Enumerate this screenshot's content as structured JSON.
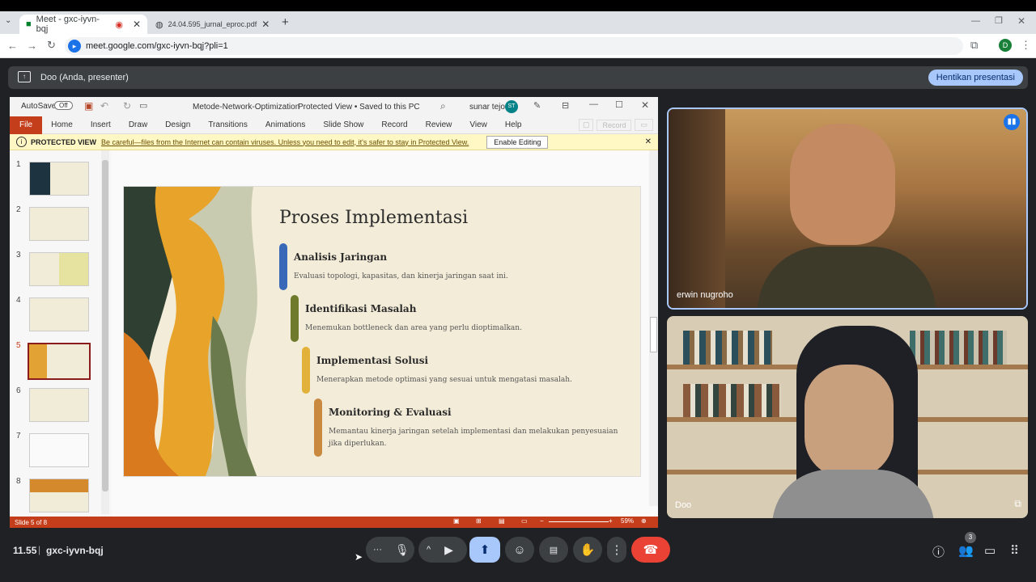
{
  "browser": {
    "tabs": [
      {
        "label": "Meet - gxc-iyvn-bqj"
      },
      {
        "label": "24.04.595_jurnal_eproc.pdf"
      }
    ],
    "url": "meet.google.com/gxc-iyvn-bqj?pli=1",
    "profile_initial": "D"
  },
  "meet": {
    "presenter_label": "Doo (Anda, presenter)",
    "stop_button": "Hentikan presentasi",
    "time": "11.55",
    "meeting_code": "gxc-iyvn-bqj",
    "participants_count": "3",
    "participants": [
      {
        "name": "erwin nugroho"
      },
      {
        "name": "Doo"
      }
    ]
  },
  "powerpoint": {
    "autosave": "AutoSave",
    "autosave_state": "Off",
    "doc_title": "Metode-Network-Optimization",
    "doc_status": "Protected View • Saved to this PC",
    "user": "sunar tejo",
    "user_initials": "ST",
    "ribbon_tabs": [
      "File",
      "Home",
      "Insert",
      "Draw",
      "Design",
      "Transitions",
      "Animations",
      "Slide Show",
      "Record",
      "Review",
      "View",
      "Help"
    ],
    "record_btn": "Record",
    "protected": {
      "label": "PROTECTED VIEW",
      "message": "Be careful—files from the Internet can contain viruses. Unless you need to edit, it's safer to stay in Protected View.",
      "button": "Enable Editing"
    },
    "slide_numbers": [
      "1",
      "2",
      "3",
      "4",
      "5",
      "6",
      "7",
      "8"
    ],
    "status": "Slide 5 of 8",
    "zoom": "59%"
  },
  "slide": {
    "title": "Proses Implementasi",
    "steps": [
      {
        "heading": "Analisis Jaringan",
        "desc": "Evaluasi topologi, kapasitas, dan kinerja jaringan saat ini.",
        "color": "#3a68b8"
      },
      {
        "heading": "Identifikasi Masalah",
        "desc": "Menemukan bottleneck dan area yang perlu dioptimalkan.",
        "color": "#6f7a2c"
      },
      {
        "heading": "Implementasi Solusi",
        "desc": "Menerapkan metode optimasi yang sesuai untuk mengatasi masalah.",
        "color": "#e2b13a"
      },
      {
        "heading": "Monitoring & Evaluasi",
        "desc": "Memantau kinerja jaringan setelah implementasi dan melakukan penyesuaian jika diperlukan.",
        "color": "#c9893e"
      }
    ]
  }
}
